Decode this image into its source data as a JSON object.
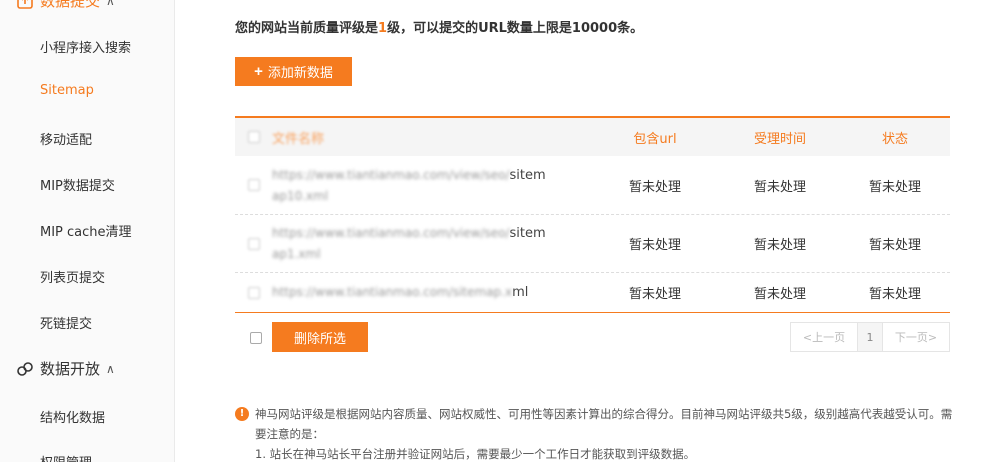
{
  "sidebar": {
    "group_top_label": "数据提交",
    "items": [
      {
        "label": "小程序接入搜索",
        "active": false
      },
      {
        "label": "Sitemap",
        "active": true
      },
      {
        "label": "移动适配",
        "active": false
      },
      {
        "label": "MIP数据提交",
        "active": false
      },
      {
        "label": "MIP cache清理",
        "active": false
      },
      {
        "label": "列表页提交",
        "active": false
      },
      {
        "label": "死链提交",
        "active": false
      }
    ],
    "group_open": {
      "label": "数据开放"
    },
    "items2": [
      {
        "label": "结构化数据"
      },
      {
        "label": "权限管理"
      }
    ]
  },
  "main": {
    "quality_prefix": "您的网站当前质量评级是",
    "quality_level": "1",
    "quality_suffix": "级，可以提交的URL数量上限是10000条。",
    "add_button": "添加新数据",
    "table": {
      "headers": {
        "name": "文件名称",
        "url": "包含url",
        "time": "受理时间",
        "status": "状态"
      },
      "rows": [
        {
          "name_blur": "https://www.tiantianmao.com/view/seo/",
          "name_clear": "sitem",
          "name_line2": "ap10.xml",
          "url": "暂未处理",
          "time": "暂未处理",
          "status": "暂未处理"
        },
        {
          "name_blur": "https://www.tiantianmao.com/view/seo/",
          "name_clear": "sitem",
          "name_line2": "ap1.xml",
          "url": "暂未处理",
          "time": "暂未处理",
          "status": "暂未处理"
        },
        {
          "name_blur": "https://www.tiantianmao.com/sitemap.x",
          "name_clear": "ml",
          "name_line2": "",
          "url": "暂未处理",
          "time": "暂未处理",
          "status": "暂未处理"
        }
      ]
    },
    "delete_button": "删除所选",
    "pager": {
      "prev": "<上一页",
      "current": "1",
      "next": "下一页>"
    },
    "notice": {
      "line1": "神马网站评级是根据网站内容质量、网站权威性、可用性等因素计算出的综合得分。目前神马网站评级共5级，级别越高代表越受认可。需要注意的是：",
      "line2": "1. 站长在神马站长平台注册并验证网站后，需要最少一个工作日才能获取到评级数据。"
    }
  },
  "colors": {
    "accent": "#f57b1f"
  }
}
